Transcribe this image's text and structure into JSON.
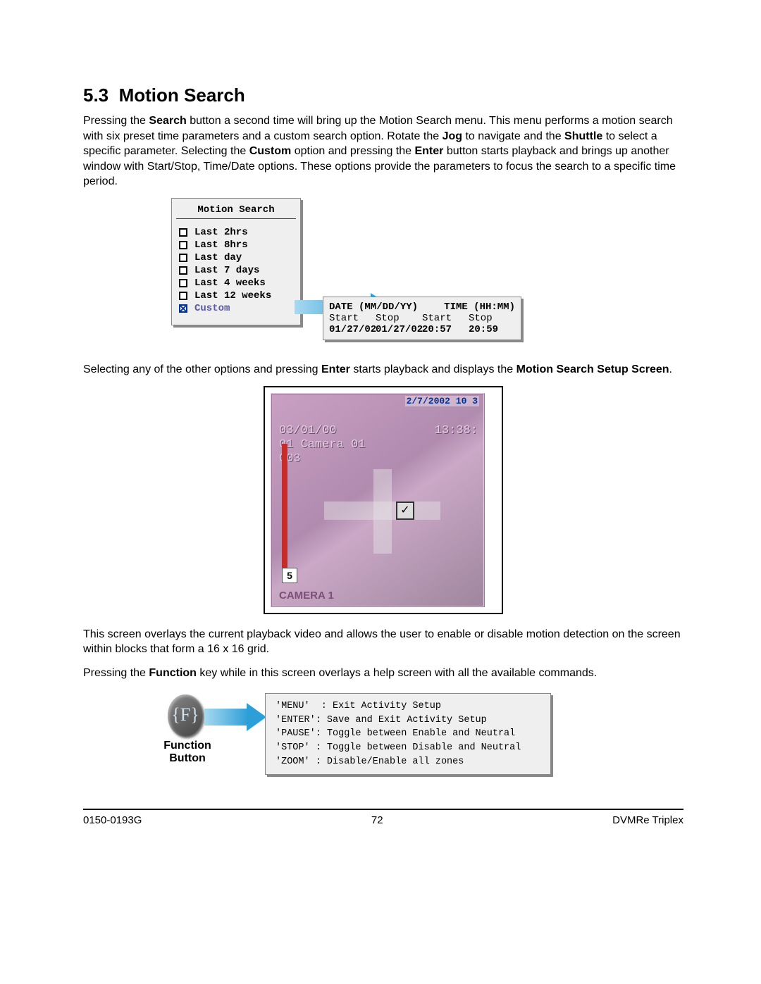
{
  "section": {
    "number": "5.3",
    "title": "Motion Search"
  },
  "para1_parts": [
    "Pressing the ",
    "Search",
    " button a second time will bring up the Motion Search menu. This menu performs a motion search with six preset time parameters and a custom search option. Rotate the ",
    "Jog",
    " to navigate and the ",
    "Shuttle",
    " to select a specific parameter. Selecting the ",
    "Custom",
    " option and pressing the ",
    "Enter",
    " button starts playback and brings up another window with Start/Stop, Time/Date options. These options provide the parameters to focus the search to a specific time period."
  ],
  "ms_menu": {
    "title": "Motion Search",
    "items": [
      {
        "label": "Last 2hrs",
        "checked": false
      },
      {
        "label": "Last 8hrs",
        "checked": false
      },
      {
        "label": "Last day",
        "checked": false
      },
      {
        "label": "Last 7 days",
        "checked": false
      },
      {
        "label": "Last 4 weeks",
        "checked": false
      },
      {
        "label": "Last 12 weeks",
        "checked": false
      },
      {
        "label": "Custom",
        "checked": true
      }
    ]
  },
  "date_box": {
    "h1a": "DATE (MM/DD/YY)",
    "h1b": "TIME (HH:MM)",
    "r2": [
      "Start",
      "Stop",
      "Start",
      "Stop"
    ],
    "r3": [
      "01/27/02",
      "01/27/02",
      "20:57",
      "20:59"
    ]
  },
  "para2_parts": [
    "Selecting any of the other options and pressing ",
    "Enter",
    " starts playback and displays the ",
    "Motion Search Setup Screen",
    "."
  ],
  "cam": {
    "topright": "2/7/2002 10 3",
    "over1": "03/01/00",
    "over2": "01 Camera 01",
    "over3": "003",
    "time": "13:38:",
    "five": "5",
    "tick": "✓",
    "label": "CAMERA 1"
  },
  "para3": "This screen overlays the current playback video and allows the user to enable or disable motion detection on the screen within blocks that form a 16 x 16 grid.",
  "para4_parts": [
    " Pressing the ",
    "Function",
    " key while in this screen overlays a help screen with all the available commands."
  ],
  "func": {
    "f": "{F}",
    "label": "Function Button",
    "help": "'MENU'  : Exit Activity Setup\n'ENTER': Save and Exit Activity Setup\n'PAUSE': Toggle between Enable and Neutral\n'STOP' : Toggle between Disable and Neutral\n'ZOOM' : Disable/Enable all zones"
  },
  "footer": {
    "left": "0150-0193G",
    "center": "72",
    "right": "DVMRe Triplex"
  }
}
